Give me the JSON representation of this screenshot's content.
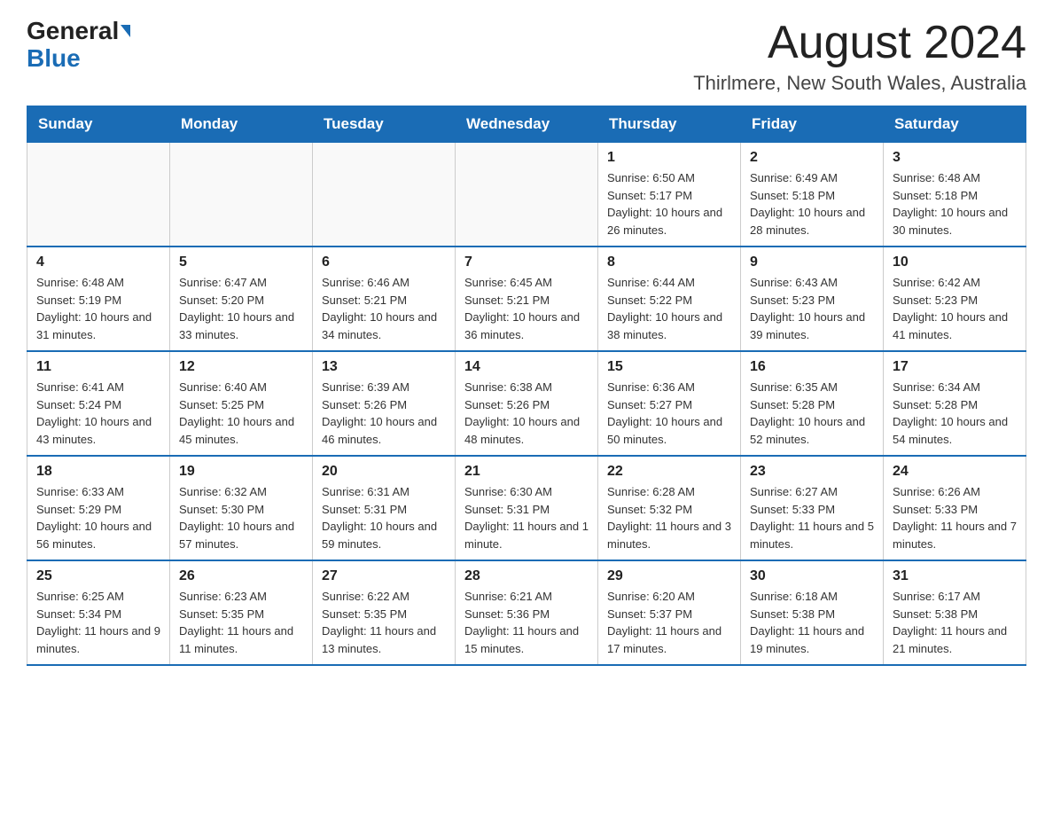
{
  "header": {
    "logo_general": "General",
    "logo_blue": "Blue",
    "month_title": "August 2024",
    "location": "Thirlmere, New South Wales, Australia"
  },
  "days_of_week": [
    "Sunday",
    "Monday",
    "Tuesday",
    "Wednesday",
    "Thursday",
    "Friday",
    "Saturday"
  ],
  "weeks": [
    [
      {
        "day": "",
        "info": ""
      },
      {
        "day": "",
        "info": ""
      },
      {
        "day": "",
        "info": ""
      },
      {
        "day": "",
        "info": ""
      },
      {
        "day": "1",
        "info": "Sunrise: 6:50 AM\nSunset: 5:17 PM\nDaylight: 10 hours and 26 minutes."
      },
      {
        "day": "2",
        "info": "Sunrise: 6:49 AM\nSunset: 5:18 PM\nDaylight: 10 hours and 28 minutes."
      },
      {
        "day": "3",
        "info": "Sunrise: 6:48 AM\nSunset: 5:18 PM\nDaylight: 10 hours and 30 minutes."
      }
    ],
    [
      {
        "day": "4",
        "info": "Sunrise: 6:48 AM\nSunset: 5:19 PM\nDaylight: 10 hours and 31 minutes."
      },
      {
        "day": "5",
        "info": "Sunrise: 6:47 AM\nSunset: 5:20 PM\nDaylight: 10 hours and 33 minutes."
      },
      {
        "day": "6",
        "info": "Sunrise: 6:46 AM\nSunset: 5:21 PM\nDaylight: 10 hours and 34 minutes."
      },
      {
        "day": "7",
        "info": "Sunrise: 6:45 AM\nSunset: 5:21 PM\nDaylight: 10 hours and 36 minutes."
      },
      {
        "day": "8",
        "info": "Sunrise: 6:44 AM\nSunset: 5:22 PM\nDaylight: 10 hours and 38 minutes."
      },
      {
        "day": "9",
        "info": "Sunrise: 6:43 AM\nSunset: 5:23 PM\nDaylight: 10 hours and 39 minutes."
      },
      {
        "day": "10",
        "info": "Sunrise: 6:42 AM\nSunset: 5:23 PM\nDaylight: 10 hours and 41 minutes."
      }
    ],
    [
      {
        "day": "11",
        "info": "Sunrise: 6:41 AM\nSunset: 5:24 PM\nDaylight: 10 hours and 43 minutes."
      },
      {
        "day": "12",
        "info": "Sunrise: 6:40 AM\nSunset: 5:25 PM\nDaylight: 10 hours and 45 minutes."
      },
      {
        "day": "13",
        "info": "Sunrise: 6:39 AM\nSunset: 5:26 PM\nDaylight: 10 hours and 46 minutes."
      },
      {
        "day": "14",
        "info": "Sunrise: 6:38 AM\nSunset: 5:26 PM\nDaylight: 10 hours and 48 minutes."
      },
      {
        "day": "15",
        "info": "Sunrise: 6:36 AM\nSunset: 5:27 PM\nDaylight: 10 hours and 50 minutes."
      },
      {
        "day": "16",
        "info": "Sunrise: 6:35 AM\nSunset: 5:28 PM\nDaylight: 10 hours and 52 minutes."
      },
      {
        "day": "17",
        "info": "Sunrise: 6:34 AM\nSunset: 5:28 PM\nDaylight: 10 hours and 54 minutes."
      }
    ],
    [
      {
        "day": "18",
        "info": "Sunrise: 6:33 AM\nSunset: 5:29 PM\nDaylight: 10 hours and 56 minutes."
      },
      {
        "day": "19",
        "info": "Sunrise: 6:32 AM\nSunset: 5:30 PM\nDaylight: 10 hours and 57 minutes."
      },
      {
        "day": "20",
        "info": "Sunrise: 6:31 AM\nSunset: 5:31 PM\nDaylight: 10 hours and 59 minutes."
      },
      {
        "day": "21",
        "info": "Sunrise: 6:30 AM\nSunset: 5:31 PM\nDaylight: 11 hours and 1 minute."
      },
      {
        "day": "22",
        "info": "Sunrise: 6:28 AM\nSunset: 5:32 PM\nDaylight: 11 hours and 3 minutes."
      },
      {
        "day": "23",
        "info": "Sunrise: 6:27 AM\nSunset: 5:33 PM\nDaylight: 11 hours and 5 minutes."
      },
      {
        "day": "24",
        "info": "Sunrise: 6:26 AM\nSunset: 5:33 PM\nDaylight: 11 hours and 7 minutes."
      }
    ],
    [
      {
        "day": "25",
        "info": "Sunrise: 6:25 AM\nSunset: 5:34 PM\nDaylight: 11 hours and 9 minutes."
      },
      {
        "day": "26",
        "info": "Sunrise: 6:23 AM\nSunset: 5:35 PM\nDaylight: 11 hours and 11 minutes."
      },
      {
        "day": "27",
        "info": "Sunrise: 6:22 AM\nSunset: 5:35 PM\nDaylight: 11 hours and 13 minutes."
      },
      {
        "day": "28",
        "info": "Sunrise: 6:21 AM\nSunset: 5:36 PM\nDaylight: 11 hours and 15 minutes."
      },
      {
        "day": "29",
        "info": "Sunrise: 6:20 AM\nSunset: 5:37 PM\nDaylight: 11 hours and 17 minutes."
      },
      {
        "day": "30",
        "info": "Sunrise: 6:18 AM\nSunset: 5:38 PM\nDaylight: 11 hours and 19 minutes."
      },
      {
        "day": "31",
        "info": "Sunrise: 6:17 AM\nSunset: 5:38 PM\nDaylight: 11 hours and 21 minutes."
      }
    ]
  ]
}
